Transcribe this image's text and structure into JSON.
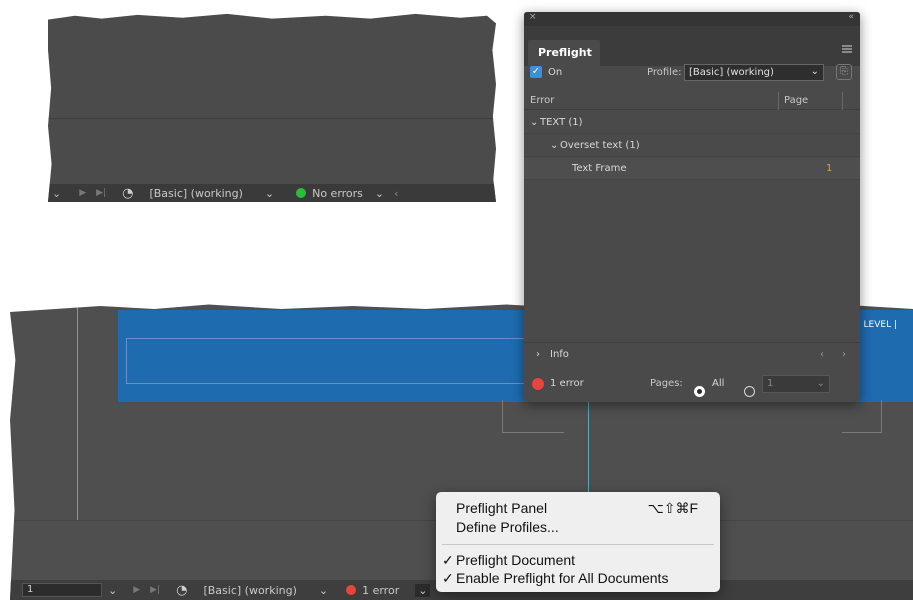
{
  "top_status": {
    "profile": "[Basic] (working)",
    "status_text": "No errors",
    "status_color": "#2dbb3b"
  },
  "bottom_status": {
    "page_number": "1",
    "profile": "[Basic] (working)",
    "status_text": "1 error",
    "status_color": "#e8453c",
    "canvas_label": "LEVEL |"
  },
  "panel": {
    "close_glyph": "×",
    "collapse_glyph": "«",
    "tab_label": "Preflight",
    "on_label": "On",
    "profile_label": "Profile:",
    "profile_value": "[Basic] (working)",
    "columns": {
      "error": "Error",
      "page": "Page"
    },
    "rows": [
      {
        "label": "TEXT (1)",
        "page": ""
      },
      {
        "label": "Overset text (1)",
        "page": ""
      },
      {
        "label": "Text Frame",
        "page": "1"
      }
    ],
    "info_label": "Info",
    "error_count": "1 error",
    "pages_label": "Pages:",
    "all_label": "All",
    "page_range": "1",
    "accent": "#3d8fd8",
    "link_color": "#e69a3a"
  },
  "popup_menu": {
    "items": [
      {
        "label": "Preflight Panel",
        "shortcut": "⌥⇧⌘F",
        "checked": false
      },
      {
        "label": "Define Profiles...",
        "shortcut": "",
        "checked": false
      },
      {
        "label": "Preflight Document",
        "shortcut": "",
        "checked": true
      },
      {
        "label": "Enable Preflight for All Documents",
        "shortcut": "",
        "checked": true
      }
    ],
    "check_glyph": "✓"
  }
}
